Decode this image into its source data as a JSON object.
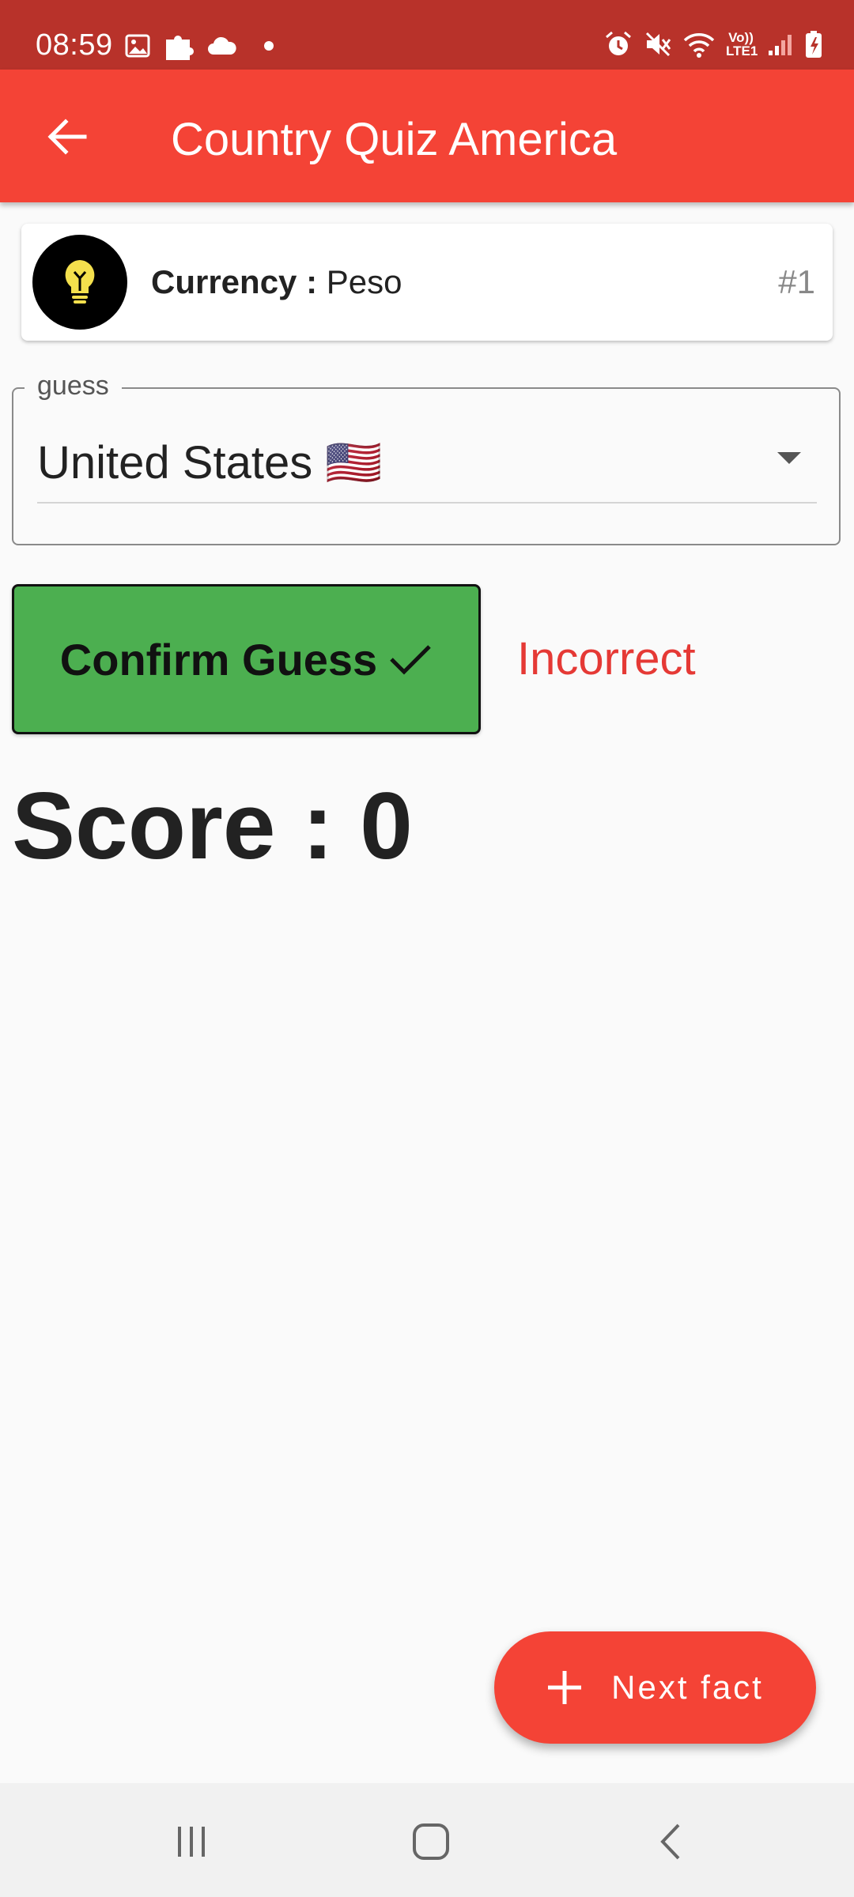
{
  "status_bar": {
    "time": "08:59",
    "network_label": "Vo))\nLTE1",
    "left_icons": [
      "image-icon",
      "puzzle-icon",
      "cloud-icon",
      "dot-icon"
    ],
    "right_icons": [
      "alarm-icon",
      "mute-icon",
      "wifi-icon",
      "signal-icon",
      "battery-charging-icon"
    ]
  },
  "app_bar": {
    "title": "Country Quiz America",
    "back_icon": "arrow-back-icon"
  },
  "fact_card": {
    "icon": "lightbulb-icon",
    "label": "Currency :",
    "value": "Peso",
    "index": "#1"
  },
  "guess_field": {
    "legend": "guess",
    "selected_value": "United States 🇺🇸"
  },
  "confirm_button": {
    "label": "Confirm Guess",
    "icon": "check-icon"
  },
  "result": {
    "text": "Incorrect"
  },
  "score": {
    "text": "Score : 0"
  },
  "fab": {
    "label": "Next fact",
    "icon": "plus-icon"
  },
  "nav_bar": {
    "icons": [
      "recent-apps-icon",
      "home-icon",
      "back-icon"
    ]
  },
  "colors": {
    "status_bar": "#b8322a",
    "app_bar": "#f44336",
    "confirm_button": "#4caf50",
    "incorrect_text": "#e53935",
    "hint_bulb": "#f4e04d",
    "background": "#fafafa"
  }
}
